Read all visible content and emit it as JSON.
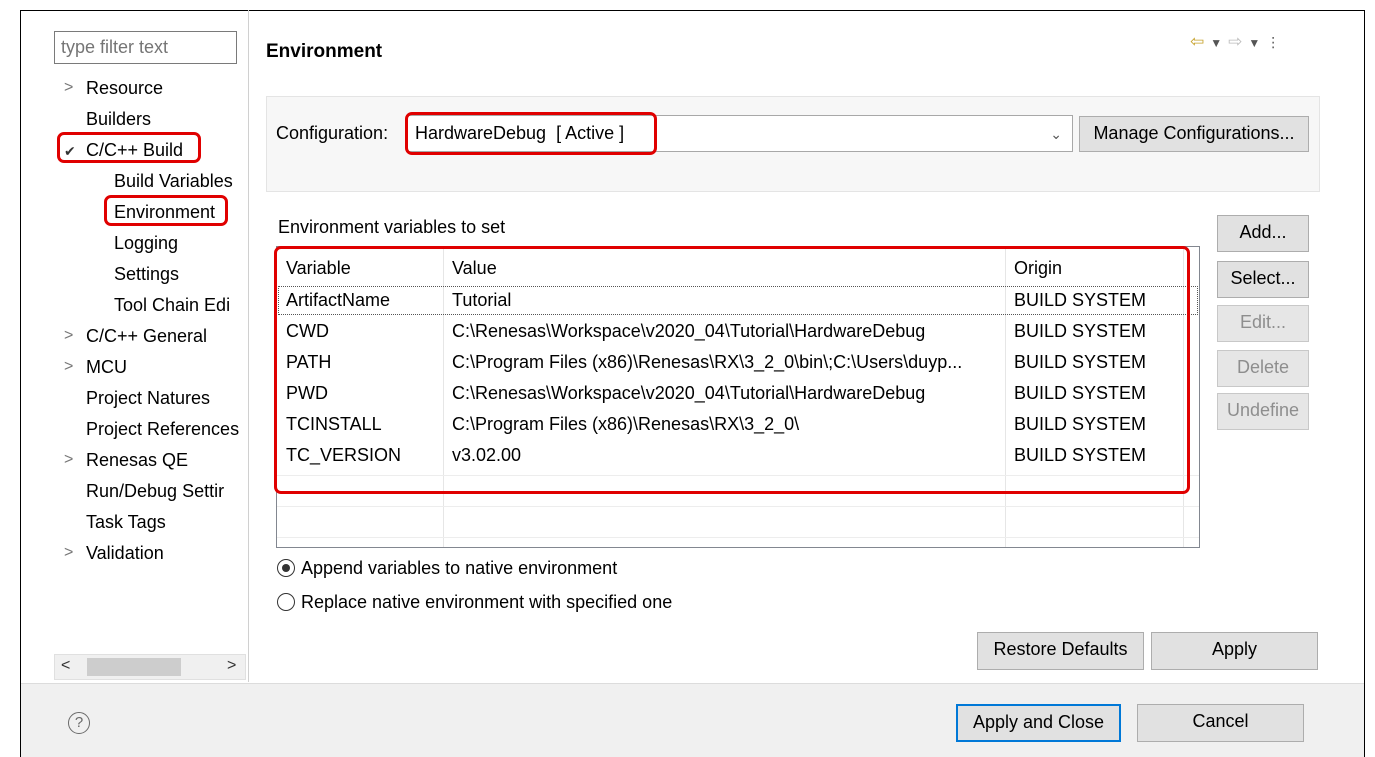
{
  "sidebar": {
    "filter_placeholder": "type filter text",
    "items": [
      {
        "label": "Resource"
      },
      {
        "label": "Builders"
      },
      {
        "label": "C/C++ Build"
      },
      {
        "label": "Build Variables"
      },
      {
        "label": "Environment"
      },
      {
        "label": "Logging"
      },
      {
        "label": "Settings"
      },
      {
        "label": "Tool Chain Edi"
      },
      {
        "label": "C/C++ General"
      },
      {
        "label": "MCU"
      },
      {
        "label": "Project Natures"
      },
      {
        "label": "Project References"
      },
      {
        "label": "Renesas QE"
      },
      {
        "label": "Run/Debug Settir"
      },
      {
        "label": "Task Tags"
      },
      {
        "label": "Validation"
      }
    ]
  },
  "page": {
    "title": "Environment",
    "configuration_label": "Configuration:",
    "configuration_value": "HardwareDebug  [ Active ]",
    "manage_button": "Manage Configurations...",
    "table_caption": "Environment variables to set",
    "columns": [
      "Variable",
      "Value",
      "Origin"
    ],
    "rows": [
      {
        "variable": "ArtifactName",
        "value": "Tutorial",
        "origin": "BUILD SYSTEM"
      },
      {
        "variable": "CWD",
        "value": "C:\\Renesas\\Workspace\\v2020_04\\Tutorial\\HardwareDebug",
        "origin": "BUILD SYSTEM"
      },
      {
        "variable": "PATH",
        "value": "C:\\Program Files (x86)\\Renesas\\RX\\3_2_0\\bin\\;C:\\Users\\duyp...",
        "origin": "BUILD SYSTEM"
      },
      {
        "variable": "PWD",
        "value": "C:\\Renesas\\Workspace\\v2020_04\\Tutorial\\HardwareDebug",
        "origin": "BUILD SYSTEM"
      },
      {
        "variable": "TCINSTALL",
        "value": "C:\\Program Files (x86)\\Renesas\\RX\\3_2_0\\",
        "origin": "BUILD SYSTEM"
      },
      {
        "variable": "TC_VERSION",
        "value": "v3.02.00",
        "origin": "BUILD SYSTEM"
      }
    ],
    "side_buttons": {
      "add": "Add...",
      "select": "Select...",
      "edit": "Edit...",
      "delete": "Delete",
      "undefine": "Undefine"
    },
    "radio_append": "Append variables to native environment",
    "radio_replace": "Replace native environment with specified one",
    "restore_defaults": "Restore Defaults",
    "apply": "Apply"
  },
  "footer": {
    "apply_and_close": "Apply and Close",
    "cancel": "Cancel"
  },
  "colors": {
    "highlight": "#e00000",
    "nav_arrow": "#c6a12a"
  }
}
